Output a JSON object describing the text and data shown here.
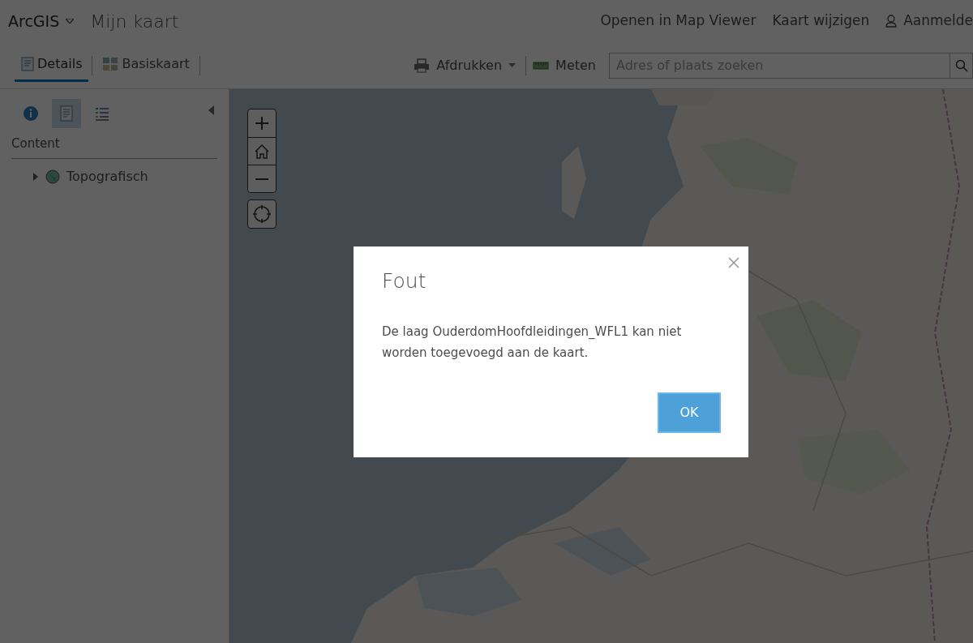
{
  "header": {
    "logo": "ArcGIS",
    "title": "Mijn kaart",
    "links": [
      "Openen in Map Viewer",
      "Kaart wijzigen"
    ],
    "sign_in": "Aanmelde"
  },
  "tabs": [
    {
      "label": "Details",
      "selected": true
    },
    {
      "label": "Basiskaart",
      "selected": false
    }
  ],
  "toolbar": {
    "print": "Afdrukken",
    "measure": "Meten",
    "search": {
      "placeholder": "Adres of plaats zoeken"
    }
  },
  "panel_tabs": [
    {
      "kind": "info",
      "selected": false
    },
    {
      "kind": "content",
      "selected": true
    },
    {
      "kind": "legend",
      "selected": false
    }
  ],
  "sidebar": {
    "heading": "Content",
    "layers": [
      {
        "label": "Topografisch",
        "expanded": false
      }
    ]
  },
  "dialog": {
    "title": "Fout",
    "message": "De laag OuderdomHoofdleidingen_WFL1 kan niet worden toegevoegd aan de kaart.",
    "button": "OK"
  }
}
